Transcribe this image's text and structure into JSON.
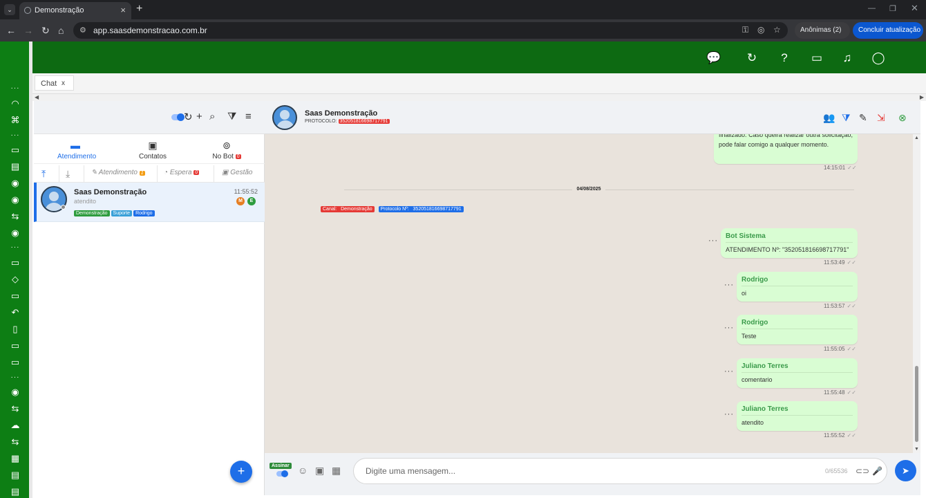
{
  "browser": {
    "tab_title": "Demonstração",
    "url": "app.saasdemonstracao.com.br",
    "incognito_label": "Anônimas (2)",
    "update_label": "Concluir atualização"
  },
  "app": {
    "chat_tab_label": "Chat",
    "chat_tab_close": "x"
  },
  "left_panel": {
    "tabs": [
      {
        "label": "Atendimento",
        "icon": "chat-bubble-icon",
        "active": true
      },
      {
        "label": "Contatos",
        "icon": "contact-card-icon"
      },
      {
        "label": "No Bot",
        "icon": "robot-icon",
        "badge": "0"
      }
    ],
    "subfilters": [
      {
        "label": "Atendimento",
        "badge": "1"
      },
      {
        "label": "Espera",
        "badge": "0"
      },
      {
        "label": "Gestão"
      }
    ],
    "conversation": {
      "name": "Saas Demonstração",
      "status": "atendito",
      "time": "11:55:52",
      "tags": [
        {
          "label": "Demonstração",
          "color": "#2e9c3e"
        },
        {
          "label": "Suporte",
          "color": "#3aa0d8"
        },
        {
          "label": "Rodrigo",
          "color": "#1e6ee8"
        }
      ],
      "avatar_circles": [
        {
          "label": "M",
          "color": "#e67e22"
        },
        {
          "label": "E",
          "color": "#2e9c3e"
        }
      ]
    },
    "fab_label": "+"
  },
  "chat": {
    "contact_name": "Saas Demonstração",
    "protocol_label": "PROTOCOLO:",
    "protocol_value": "352051816698717791",
    "first_message_text": "finalizado. Caso queira realizar outra solicitação, pode falar comigo a qualquer momento.",
    "first_message_time": "14:15:01",
    "date_separator": "04/08/2025",
    "channel_label": "Canal:",
    "channel_value": "Demonstração",
    "protocol_chip_label": "Protocolo Nº:",
    "protocol_chip_value": "352051816698717791",
    "messages": [
      {
        "author": "Bot Sistema",
        "text": "ATENDIMENTO Nº: \"352051816698717791\"",
        "time": "11:53:49"
      },
      {
        "author": "Rodrigo",
        "text": "oi",
        "time": "11:53:57"
      },
      {
        "author": "Rodrigo",
        "text": "Teste",
        "time": "11:55:05"
      },
      {
        "author": "Juliano Terres",
        "text": "comentario",
        "time": "11:55:48"
      },
      {
        "author": "Juliano Terres",
        "text": "atendito",
        "time": "11:55:52"
      }
    ],
    "checkmarks": "✓✓",
    "footer": {
      "assinar_label": "Assinar",
      "input_placeholder": "Digite uma mensagem...",
      "char_counter": "0/65536"
    }
  },
  "colors": {
    "brand_green": "#0d7e14",
    "topbar_green": "#0d6a12",
    "accent_blue": "#1e6ee8",
    "bubble_green": "#d9fdd3",
    "alert_red": "#e53935"
  }
}
